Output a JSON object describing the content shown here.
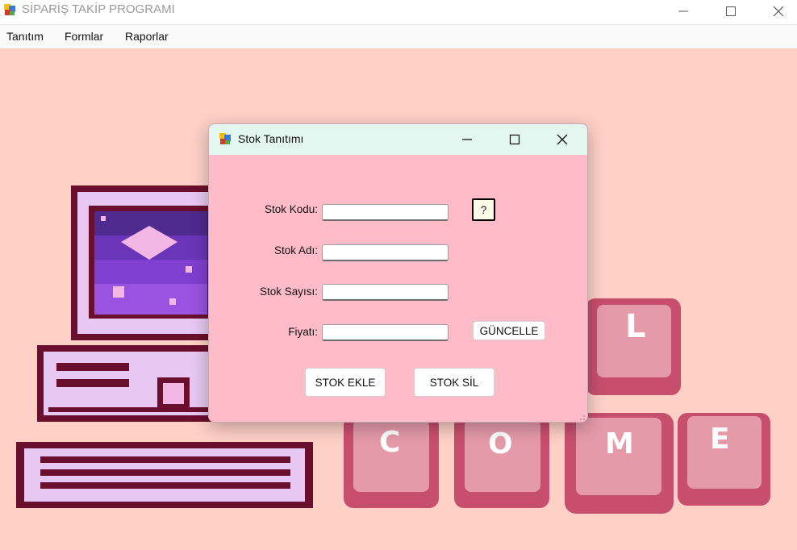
{
  "window": {
    "title": "SİPARİŞ TAKİP PROGRAMI"
  },
  "menu": [
    "Tanıtım",
    "Formlar",
    "Raporlar"
  ],
  "background": {
    "keys": [
      "L",
      "C",
      "O",
      "M",
      "E"
    ]
  },
  "dialog": {
    "title": "Stok Tanıtımı",
    "fields": {
      "stok_kodu": {
        "label": "Stok Kodu:",
        "value": ""
      },
      "stok_adi": {
        "label": "Stok Adı:",
        "value": ""
      },
      "stok_sayisi": {
        "label": "Stok Sayısı:",
        "value": ""
      },
      "fiyati": {
        "label": "Fiyatı:",
        "value": ""
      }
    },
    "help_label": "?",
    "update_label": "GÜNCELLE",
    "add_label": "STOK EKLE",
    "delete_label": "STOK SİL"
  },
  "colors": {
    "desktop_bg": "#fed0c6",
    "dialog_bg": "#ffbcc8",
    "dialog_titlebar": "#e3f6f0",
    "key_pink": "#d8647f"
  }
}
